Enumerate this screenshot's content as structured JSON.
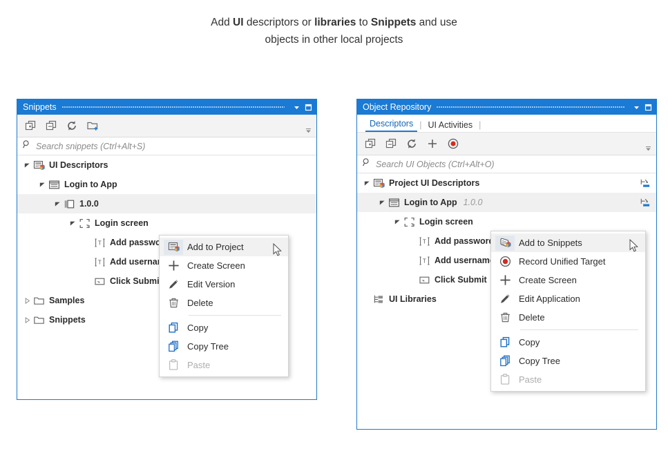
{
  "caption": {
    "line1_parts": [
      "Add ",
      "UI",
      " descriptors or ",
      "libraries",
      " to ",
      "Snippets",
      " and use"
    ],
    "line2": "objects in other local projects",
    "full_text": "Add UI descriptors or libraries to Snippets and use objects in other local projects"
  },
  "colors": {
    "title_bar_blue": "#1a7ad4",
    "panel_border_blue": "#1f78c8",
    "tab_active_blue": "#1265b5",
    "toolbar_bg": "#f3f3f3",
    "selection_gray": "#f0f0f0",
    "record_red": "#d93025",
    "icon_blue": "#1f6fc4"
  },
  "snippets_panel": {
    "title": "Snippets",
    "title_buttons": [
      {
        "name": "minimize-dropdown-button",
        "glyph": "▾"
      },
      {
        "name": "restore-window-button",
        "glyph": "□"
      }
    ],
    "toolbar": [
      {
        "name": "expand-all-icon",
        "label": "Expand All"
      },
      {
        "name": "collapse-all-icon",
        "label": "Collapse All"
      },
      {
        "name": "refresh-icon",
        "label": "Refresh"
      },
      {
        "name": "new-folder-icon",
        "label": "New Folder"
      }
    ],
    "toolbar_overflow_label": "More",
    "search_placeholder": "Search snippets (Ctrl+Alt+S)",
    "tree": [
      {
        "label": "UI Descriptors",
        "indent": 0,
        "arrow": "expanded",
        "icon": "ui-descriptors-icon",
        "version": "",
        "selected": false
      },
      {
        "label": "Login to App",
        "indent": 1,
        "arrow": "expanded",
        "icon": "application-icon",
        "version": "",
        "selected": false
      },
      {
        "label": "1.0.0",
        "indent": 2,
        "arrow": "expanded",
        "icon": "version-icon",
        "version": "",
        "selected": true
      },
      {
        "label": "Login screen",
        "indent": 3,
        "arrow": "expanded",
        "icon": "screen-icon",
        "version": "",
        "selected": false
      },
      {
        "label": "Add password",
        "indent": 4,
        "arrow": "none",
        "icon": "text-field-icon",
        "version": "",
        "selected": false
      },
      {
        "label": "Add username",
        "indent": 4,
        "arrow": "none",
        "icon": "text-field-icon",
        "version": "",
        "selected": false
      },
      {
        "label": "Click Submit",
        "indent": 4,
        "arrow": "none",
        "icon": "button-icon",
        "version": "",
        "selected": false
      },
      {
        "label": "Samples",
        "indent": 0,
        "arrow": "collapsed",
        "icon": "folder-icon",
        "version": "",
        "selected": false
      },
      {
        "label": "Snippets",
        "indent": 0,
        "arrow": "collapsed",
        "icon": "folder-icon",
        "version": "",
        "selected": false
      }
    ],
    "context_menu": [
      {
        "label": "Add to Project",
        "icon": "add-to-project-icon",
        "highlighted": true,
        "disabled": false,
        "separator_after": false
      },
      {
        "label": "Create Screen",
        "icon": "plus-icon",
        "highlighted": false,
        "disabled": false,
        "separator_after": false
      },
      {
        "label": "Edit Version",
        "icon": "pencil-icon",
        "highlighted": false,
        "disabled": false,
        "separator_after": false
      },
      {
        "label": "Delete",
        "icon": "trash-icon",
        "highlighted": false,
        "disabled": false,
        "separator_after": true
      },
      {
        "label": "Copy",
        "icon": "copy-icon",
        "highlighted": false,
        "disabled": false,
        "separator_after": false
      },
      {
        "label": "Copy Tree",
        "icon": "copy-tree-icon",
        "highlighted": false,
        "disabled": false,
        "separator_after": false
      },
      {
        "label": "Paste",
        "icon": "paste-icon",
        "highlighted": false,
        "disabled": true,
        "separator_after": false
      }
    ]
  },
  "object_repository_panel": {
    "title": "Object Repository",
    "title_buttons": [
      {
        "name": "minimize-dropdown-button",
        "glyph": "▾"
      },
      {
        "name": "restore-window-button",
        "glyph": "□"
      }
    ],
    "tabs": [
      {
        "label": "Descriptors",
        "active": true
      },
      {
        "label": "UI Activities",
        "active": false
      }
    ],
    "toolbar": [
      {
        "name": "expand-all-icon",
        "label": "Expand All"
      },
      {
        "name": "collapse-all-icon",
        "label": "Collapse All"
      },
      {
        "name": "refresh-icon",
        "label": "Refresh"
      },
      {
        "name": "add-icon",
        "label": "Add"
      },
      {
        "name": "record-icon",
        "label": "Record"
      }
    ],
    "toolbar_overflow_label": "More",
    "search_placeholder": "Search UI Objects (Ctrl+Alt+O)",
    "tree": [
      {
        "label": "Project UI Descriptors",
        "indent": 0,
        "arrow": "expanded",
        "icon": "ui-descriptors-icon",
        "version": "",
        "selected": false,
        "badge": "import-badge-icon"
      },
      {
        "label": "Login to App",
        "indent": 1,
        "arrow": "expanded",
        "icon": "application-icon",
        "version": "1.0.0",
        "selected": true,
        "badge": "import-badge-icon"
      },
      {
        "label": "Login screen",
        "indent": 2,
        "arrow": "expanded",
        "icon": "screen-icon",
        "version": "",
        "selected": false,
        "badge": ""
      },
      {
        "label": "Add password",
        "indent": 3,
        "arrow": "none",
        "icon": "text-field-icon",
        "version": "",
        "selected": false,
        "badge": ""
      },
      {
        "label": "Add username",
        "indent": 3,
        "arrow": "none",
        "icon": "text-field-icon",
        "version": "",
        "selected": false,
        "badge": ""
      },
      {
        "label": "Click Submit",
        "indent": 3,
        "arrow": "none",
        "icon": "button-icon",
        "version": "",
        "selected": false,
        "badge": ""
      },
      {
        "label": "UI Libraries",
        "indent": 0,
        "arrow": "none",
        "icon": "ui-libraries-icon",
        "version": "",
        "selected": false,
        "badge": ""
      }
    ],
    "context_menu": [
      {
        "label": "Add to Snippets",
        "icon": "add-to-snippets-icon",
        "highlighted": true,
        "disabled": false,
        "separator_after": false
      },
      {
        "label": "Record Unified Target",
        "icon": "record-icon",
        "highlighted": false,
        "disabled": false,
        "separator_after": false
      },
      {
        "label": "Create Screen",
        "icon": "plus-icon",
        "highlighted": false,
        "disabled": false,
        "separator_after": false
      },
      {
        "label": "Edit Application",
        "icon": "pencil-icon",
        "highlighted": false,
        "disabled": false,
        "separator_after": false
      },
      {
        "label": "Delete",
        "icon": "trash-icon",
        "highlighted": false,
        "disabled": false,
        "separator_after": true
      },
      {
        "label": "Copy",
        "icon": "copy-icon",
        "highlighted": false,
        "disabled": false,
        "separator_after": false
      },
      {
        "label": "Copy Tree",
        "icon": "copy-tree-icon",
        "highlighted": false,
        "disabled": false,
        "separator_after": false
      },
      {
        "label": "Paste",
        "icon": "paste-icon",
        "highlighted": false,
        "disabled": true,
        "separator_after": false
      }
    ]
  }
}
